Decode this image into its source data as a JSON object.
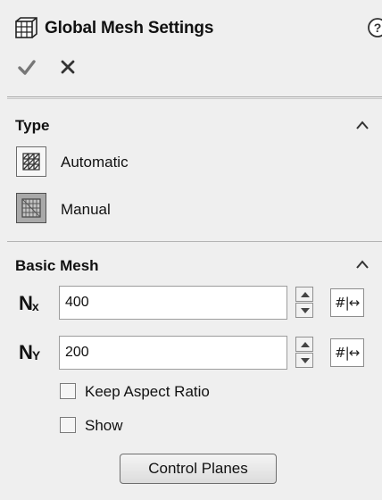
{
  "header": {
    "title": "Global Mesh Settings",
    "icon": "grid-cube-icon",
    "help_icon": "question-circle-icon",
    "ok_icon": "checkmark-icon",
    "cancel_icon": "x-icon"
  },
  "type_section": {
    "title": "Type",
    "options": [
      {
        "label": "Automatic",
        "icon": "auto-mesh-icon",
        "selected": false
      },
      {
        "label": "Manual",
        "icon": "manual-mesh-icon",
        "selected": true
      }
    ]
  },
  "basic_mesh": {
    "title": "Basic Mesh",
    "nx": {
      "label_main": "N",
      "label_sub": "x",
      "value": "400"
    },
    "ny": {
      "label_main": "N",
      "label_sub": "Y",
      "value": "200"
    },
    "grid_button_glyph": "#|↔",
    "keep_aspect_ratio": {
      "label": "Keep Aspect Ratio",
      "checked": false
    },
    "show": {
      "label": "Show",
      "checked": false
    },
    "control_planes_label": "Control Planes"
  },
  "colors": {
    "panel_bg": "#efefef",
    "active_option_bg": "#a9a9a9",
    "check_green": "#7a7a7a"
  }
}
